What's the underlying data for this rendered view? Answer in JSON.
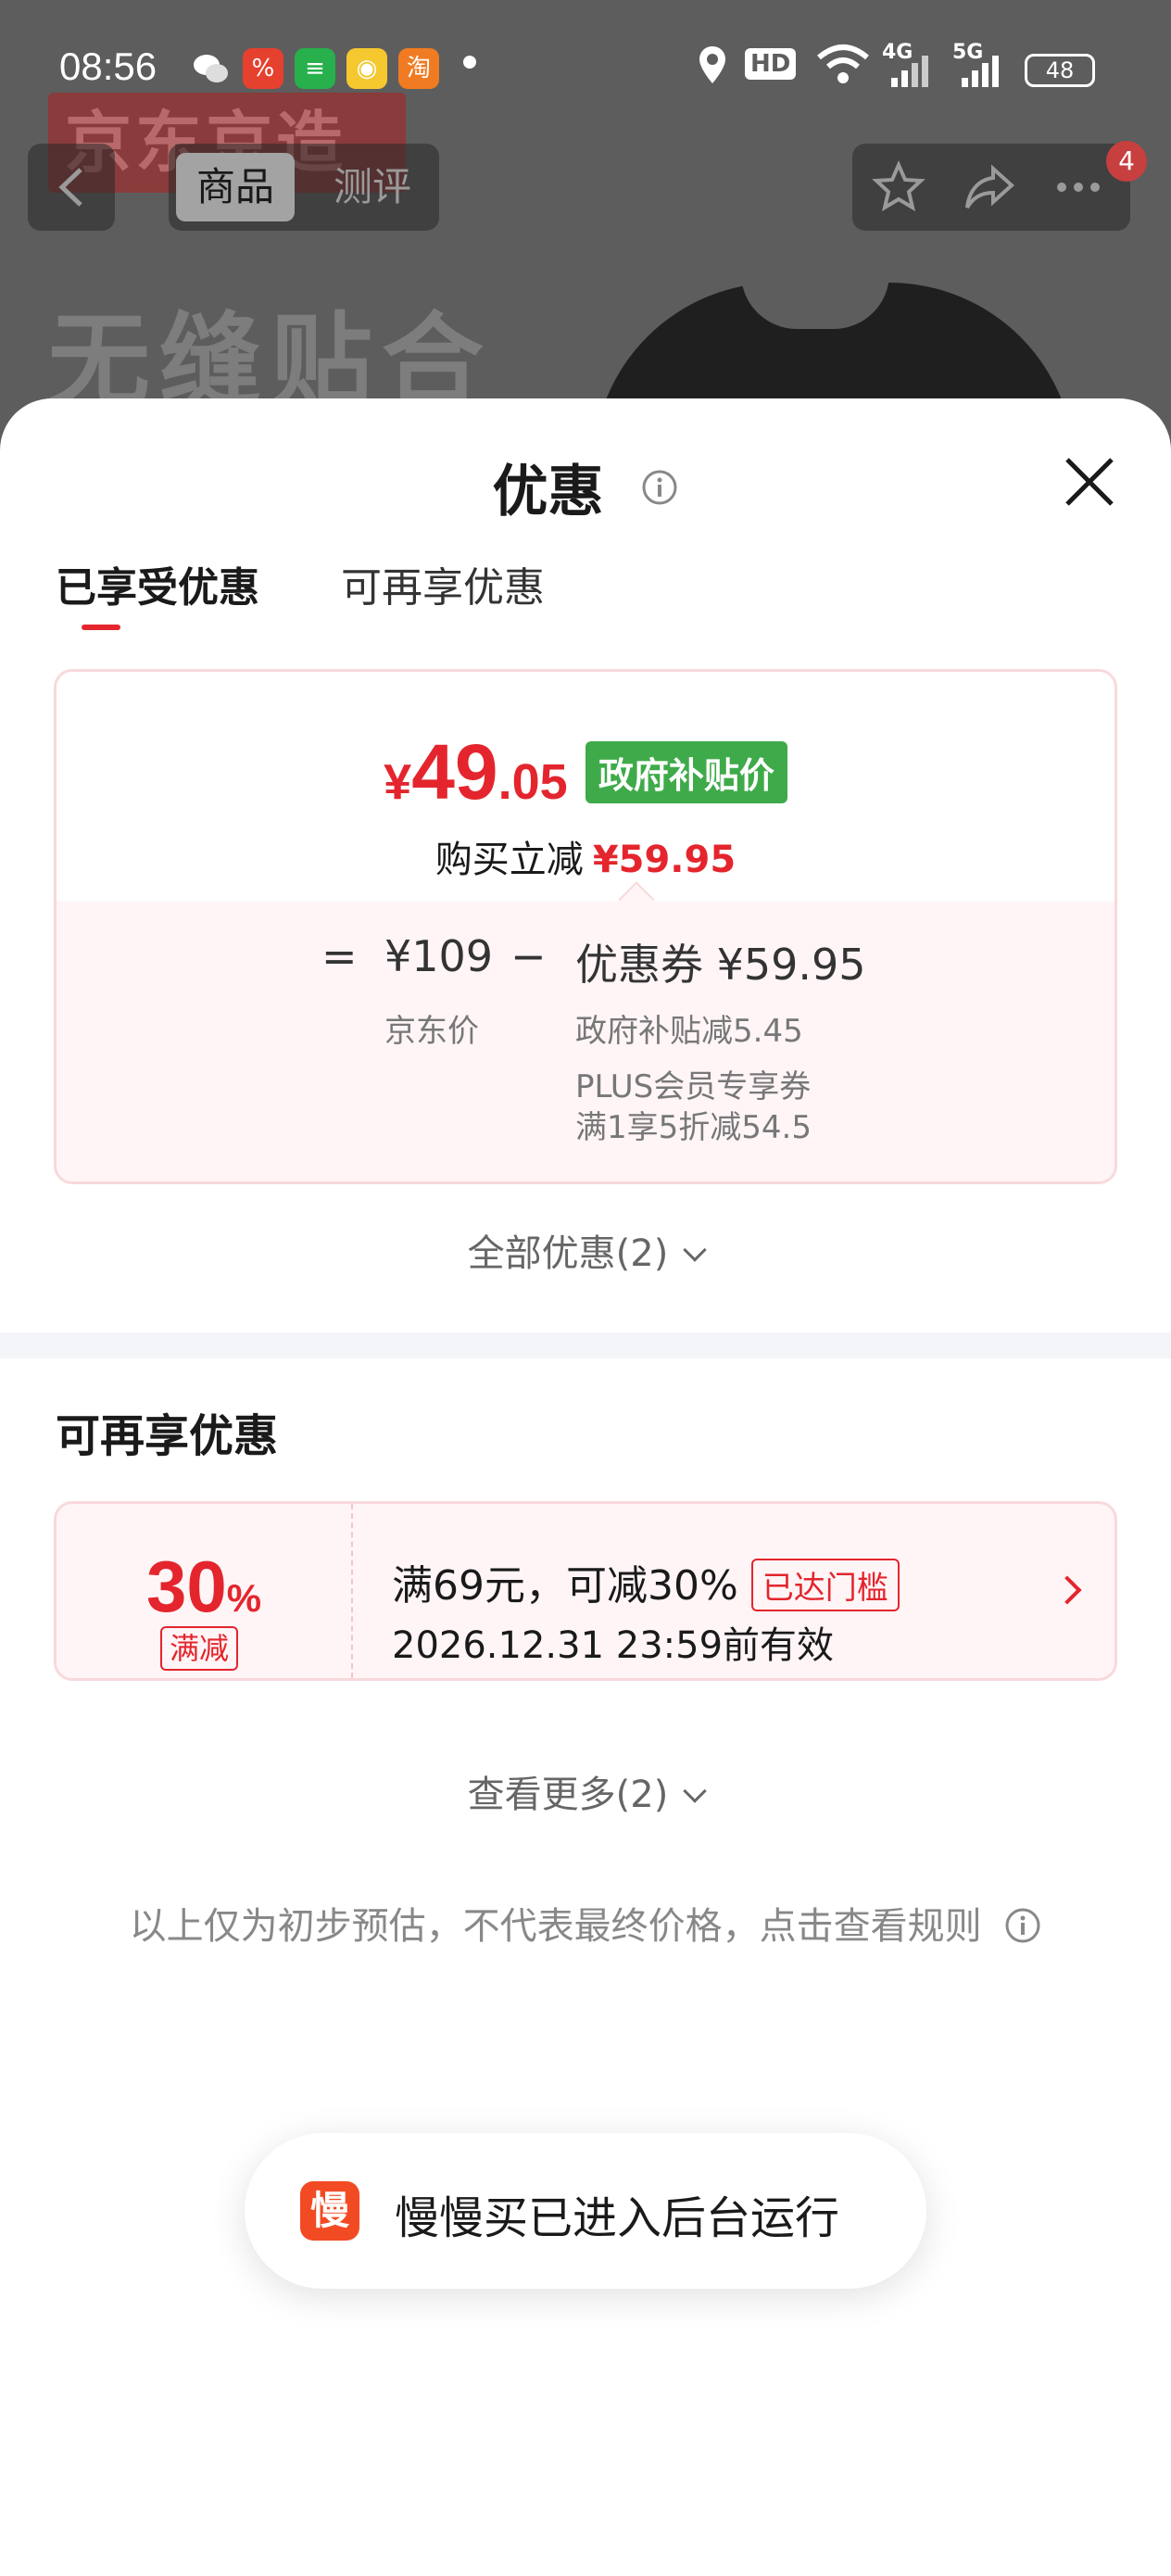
{
  "status_bar": {
    "time": "08:56",
    "apps": [
      "wechat-icon",
      "app-icon",
      "message-icon",
      "weibo-icon",
      "taobao-icon"
    ],
    "taobao_label": "淘",
    "network_labels": [
      "HD",
      "4G",
      "5G"
    ],
    "battery": "48"
  },
  "background": {
    "banner": "京东京造",
    "slogan": "无缝贴合",
    "nav_tabs": [
      "商品",
      "测评"
    ],
    "cart_badge": "4"
  },
  "sheet": {
    "title": "优惠",
    "tabs": [
      "已享受优惠",
      "可再享优惠"
    ],
    "summary": {
      "price_yen": "¥",
      "price_int": "49",
      "price_dec": ".05",
      "gov_tag": "政府补贴价",
      "reduce_label": "购买立减",
      "reduce_value": "¥59.95",
      "eq": "=",
      "jd_price": "¥109",
      "jd_price_label": "京东价",
      "minus": "−",
      "coupon_label": "优惠券 ¥59.95",
      "coupon_detail_1": "政府补贴减5.45",
      "coupon_detail_2": "PLUS会员专享券",
      "coupon_detail_3": "满1享5折减54.5"
    },
    "all_offers": "全部优惠(2)",
    "more_section_title": "可再享优惠",
    "coupon": {
      "percent": "30",
      "percent_sign": "%",
      "type": "满减",
      "desc": "满69元，可减30%",
      "status": "已达门槛",
      "validity": "2026.12.31 23:59前有效"
    },
    "see_more": "查看更多(2)",
    "disclaimer": "以上仅为初步预估，不代表最终价格，点击查看规则"
  },
  "toast": {
    "icon_char": "慢",
    "text": "慢慢买已进入后台运行"
  },
  "colors": {
    "accent": "#e4252d",
    "gov_green": "#3faa4a",
    "toast_icon": "#f24b24"
  }
}
